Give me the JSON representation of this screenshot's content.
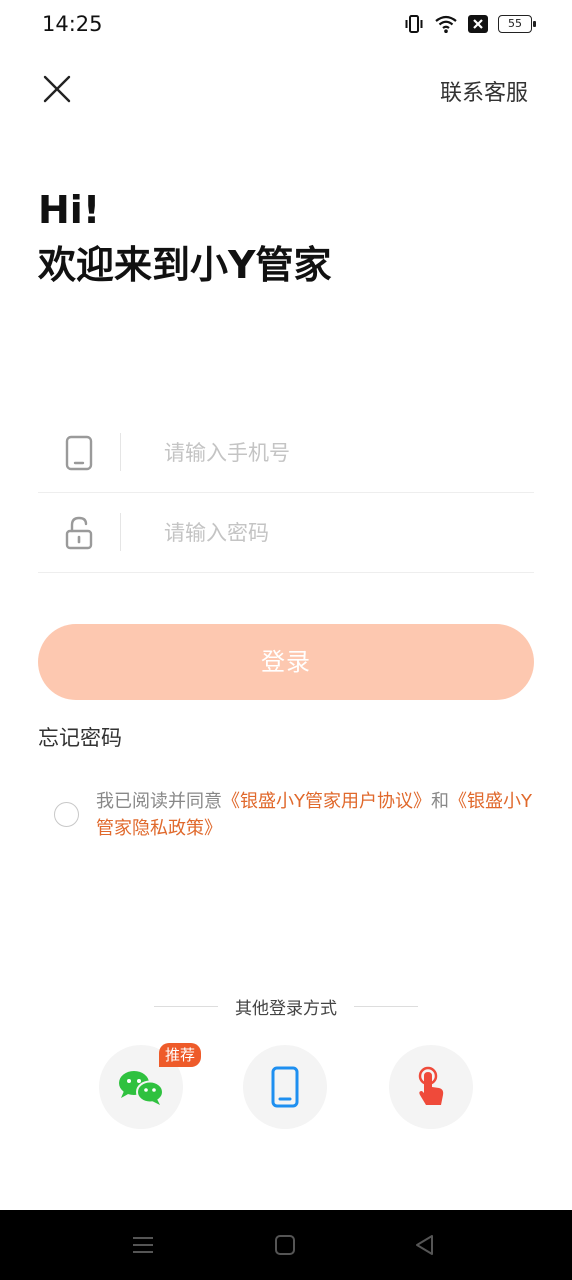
{
  "status_bar": {
    "time": "14:25",
    "battery": "55",
    "icons": [
      "vibrate-icon",
      "wifi-icon",
      "no-sim-icon",
      "battery-icon"
    ]
  },
  "header": {
    "close_icon": "close-icon",
    "support_label": "联系客服"
  },
  "greeting": {
    "line1": "Hi!",
    "line2": "欢迎来到小Y管家"
  },
  "form": {
    "phone": {
      "icon": "phone-icon",
      "placeholder": "请输入手机号",
      "value": ""
    },
    "password": {
      "icon": "unlock-icon",
      "placeholder": "请输入密码",
      "value": ""
    },
    "login_label": "登录",
    "forgot_label": "忘记密码"
  },
  "agreement": {
    "prefix": "我已阅读并同意",
    "link1": "《银盛小Y管家用户协议》",
    "joiner": "和",
    "link2": "《银盛小Y管家隐私政策》",
    "checked": false
  },
  "other_login": {
    "title": "其他登录方式",
    "methods": [
      {
        "name": "wechat",
        "icon": "wechat-icon",
        "badge": "推荐"
      },
      {
        "name": "phone",
        "icon": "mobile-icon"
      },
      {
        "name": "fingerprint",
        "icon": "touch-icon"
      }
    ]
  },
  "colors": {
    "accent": "#e0692c",
    "login_button": "#fdc8b0",
    "badge": "#ee5b2a",
    "wechat": "#2fc13f",
    "phone_icon": "#1e8ff0",
    "touch_icon": "#ef4a3a"
  },
  "nav_bar": {
    "icons": [
      "menu-icon",
      "home-icon",
      "back-icon"
    ]
  }
}
